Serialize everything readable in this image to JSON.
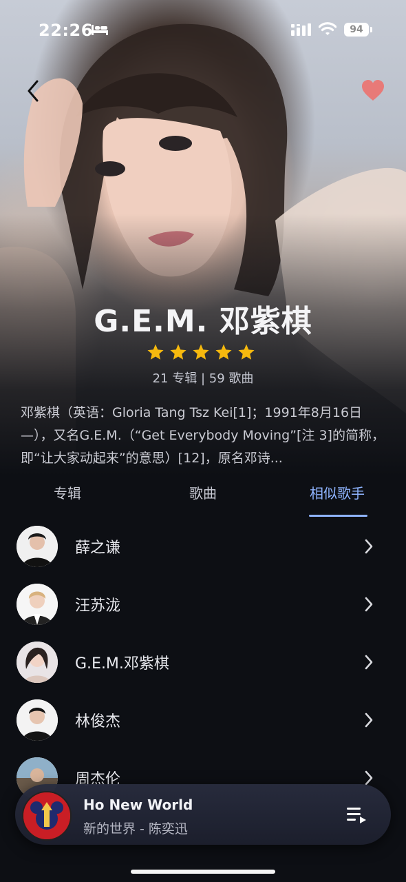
{
  "status_bar": {
    "time": "22:26",
    "battery": "94",
    "icons": [
      "bed-icon",
      "signal-icon",
      "wifi-icon",
      "battery-icon"
    ]
  },
  "header": {
    "back_icon": "chevron-left-icon",
    "favorite_icon": "heart-icon",
    "favorite_color": "#e87a78"
  },
  "artist": {
    "name": "G.E.M. 邓紫棋",
    "rating": 5,
    "rating_max": 5,
    "star_color": "#f6b90e",
    "stats": "21 专辑 | 59 歌曲",
    "bio": "邓紫棋（英语：Gloria Tang Tsz Kei[1]；1991年8月16日—），又名G.E.M.（“Get Everybody Moving”[注 3]的简称，即“让大家动起来”的意思）[12]，原名邓诗..."
  },
  "tabs": [
    {
      "label": "专辑",
      "active": false
    },
    {
      "label": "歌曲",
      "active": false
    },
    {
      "label": "相似歌手",
      "active": true
    }
  ],
  "accent_color": "#8fb4ff",
  "similar_artists": [
    {
      "name": "薛之谦"
    },
    {
      "name": "汪苏泷"
    },
    {
      "name": "G.E.M.邓紫棋"
    },
    {
      "name": "林俊杰"
    },
    {
      "name": "周杰伦"
    }
  ],
  "player": {
    "title": "Ho New World",
    "subtitle": "新的世界 - 陈奕迅",
    "playlist_icon": "playlist-icon"
  }
}
